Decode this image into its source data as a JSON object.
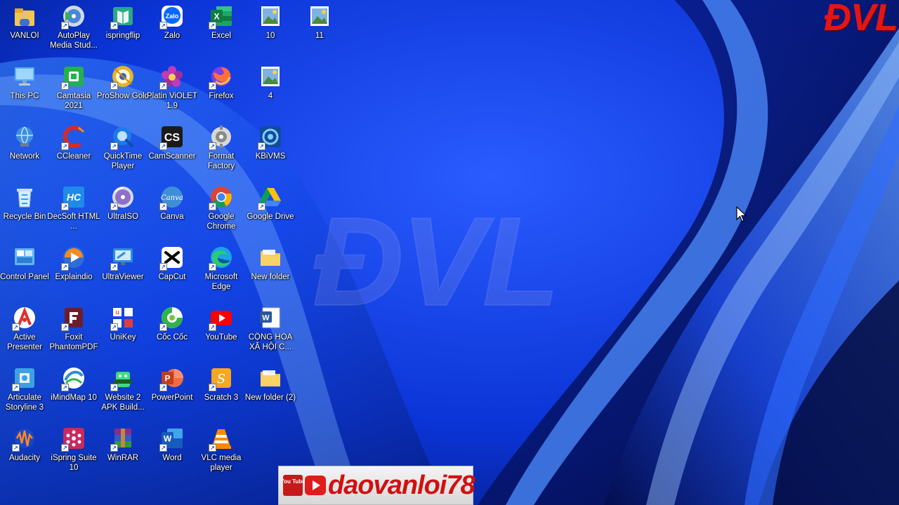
{
  "desktop": {
    "icons": [
      {
        "label": "VANLOI",
        "icon": "user-folder-icon"
      },
      {
        "label": "AutoPlay Media Stud...",
        "icon": "autoplay-icon"
      },
      {
        "label": "ispringflip",
        "icon": "ispringflip-icon"
      },
      {
        "label": "Zalo",
        "icon": "zalo-icon"
      },
      {
        "label": "Excel",
        "icon": "excel-icon"
      },
      {
        "label": "10",
        "icon": "image-file-icon"
      },
      {
        "label": "11",
        "icon": "image-file-icon"
      },
      {
        "label": "This PC",
        "icon": "this-pc-icon"
      },
      {
        "label": "Camtasia 2021",
        "icon": "camtasia-icon"
      },
      {
        "label": "ProShow Gold",
        "icon": "proshow-icon"
      },
      {
        "label": "Platin ViOLET 1.9",
        "icon": "violet-icon"
      },
      {
        "label": "Firefox",
        "icon": "firefox-icon"
      },
      {
        "label": "4",
        "icon": "image-file-icon"
      },
      {
        "label": "Network",
        "icon": "network-icon"
      },
      {
        "label": "CCleaner",
        "icon": "ccleaner-icon"
      },
      {
        "label": "QuickTime Player",
        "icon": "quicktime-icon"
      },
      {
        "label": "CamScanner",
        "icon": "camscanner-icon"
      },
      {
        "label": "Format Factory",
        "icon": "format-factory-icon"
      },
      {
        "label": "KBiVMS",
        "icon": "kbivms-icon"
      },
      {
        "label": "Recycle Bin",
        "icon": "recycle-bin-icon"
      },
      {
        "label": "DecSoft HTML ...",
        "icon": "decsoft-icon"
      },
      {
        "label": "UltraISO",
        "icon": "ultraiso-icon"
      },
      {
        "label": "Canva",
        "icon": "canva-icon"
      },
      {
        "label": "Google Chrome",
        "icon": "chrome-icon"
      },
      {
        "label": "Google Drive",
        "icon": "google-drive-icon"
      },
      {
        "label": "Control Panel",
        "icon": "control-panel-icon"
      },
      {
        "label": "Explaindio",
        "icon": "explaindio-icon"
      },
      {
        "label": "UltraViewer",
        "icon": "ultraviewer-icon"
      },
      {
        "label": "CapCut",
        "icon": "capcut-icon"
      },
      {
        "label": "Microsoft Edge",
        "icon": "edge-icon"
      },
      {
        "label": "New folder",
        "icon": "folder-icon"
      },
      {
        "label": "Active Presenter",
        "icon": "active-presenter-icon"
      },
      {
        "label": "Foxit PhantomPDF",
        "icon": "foxit-icon"
      },
      {
        "label": "UniKey",
        "icon": "unikey-icon"
      },
      {
        "label": "Cốc Cốc",
        "icon": "coccoc-icon"
      },
      {
        "label": "YouTube",
        "icon": "youtube-icon"
      },
      {
        "label": "CỘNG HÒA XÃ HỘI C...",
        "icon": "word-doc-icon"
      },
      {
        "label": "Articulate Storyline 3",
        "icon": "storyline-icon"
      },
      {
        "label": "iMindMap 10",
        "icon": "imindmap-icon"
      },
      {
        "label": "Website 2 APK Build...",
        "icon": "apk-builder-icon"
      },
      {
        "label": "PowerPoint",
        "icon": "powerpoint-icon"
      },
      {
        "label": "Scratch 3",
        "icon": "scratch-icon"
      },
      {
        "label": "New folder (2)",
        "icon": "folder-icon"
      },
      {
        "label": "Audacity",
        "icon": "audacity-icon"
      },
      {
        "label": "iSpring Suite 10",
        "icon": "ispring-suite-icon"
      },
      {
        "label": "WinRAR",
        "icon": "winrar-icon"
      },
      {
        "label": "Word",
        "icon": "word-icon"
      },
      {
        "label": "VLC media player",
        "icon": "vlc-icon"
      }
    ]
  },
  "overlay": {
    "brand_top": "ĐVL",
    "watermark": "ĐVL",
    "channel_name": "daovanloi78",
    "yt_small": "You Tube"
  },
  "colors": {
    "brand_red": "#e31616",
    "wallpaper_blue": "#0a2fd0"
  }
}
